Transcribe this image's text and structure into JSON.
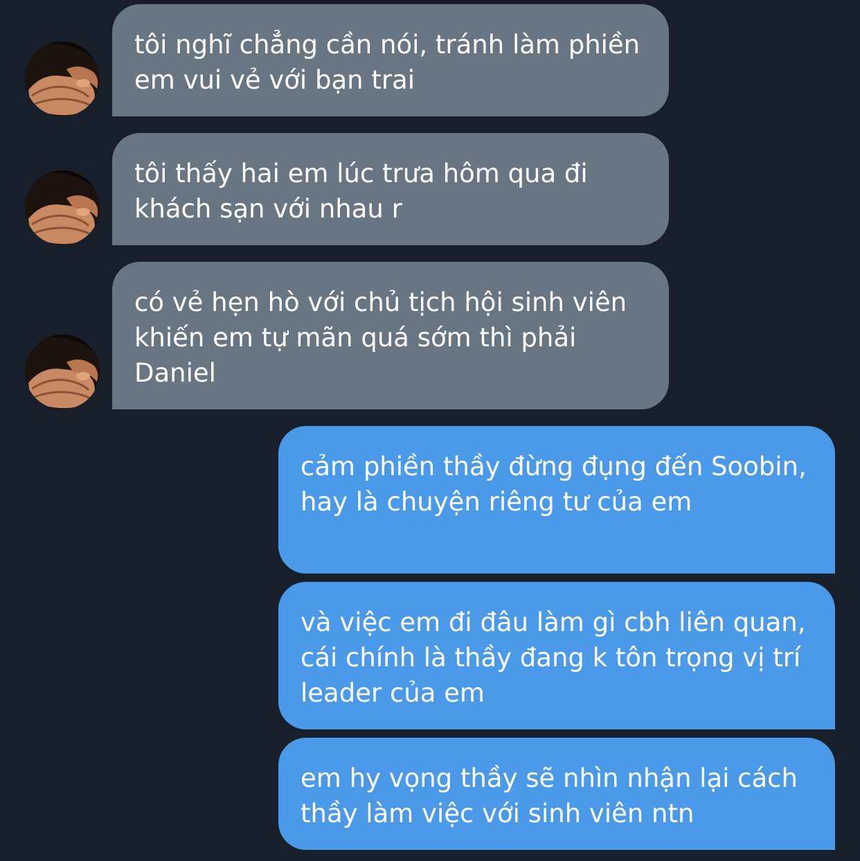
{
  "messages": [
    {
      "direction": "incoming",
      "text": "tôi nghĩ chẳng cần nói, tránh làm phiền em vui vẻ với bạn trai"
    },
    {
      "direction": "incoming",
      "text": "tôi thấy hai em lúc trưa hôm qua đi khách sạn với nhau r"
    },
    {
      "direction": "incoming",
      "text": "có vẻ hẹn hò với chủ tịch hội sinh viên khiến em tự mãn quá sớm thì phải Daniel"
    },
    {
      "direction": "outgoing",
      "text": "cảm phiền thầy đừng đụng đến Soobin, hay là chuyện riêng tư của em"
    },
    {
      "direction": "outgoing",
      "text": "và việc em đi đâu làm gì cbh liên quan, cái chính là thầy đang k tôn trọng vị trí leader của em"
    },
    {
      "direction": "outgoing",
      "text": "em hy vọng thầy sẽ nhìn nhận lại cách thầy làm việc với sinh viên ntn"
    }
  ],
  "colors": {
    "background": "#17202a",
    "incoming_bubble": "#687583",
    "outgoing_bubble": "#4a9ae9",
    "text": "#ffffff"
  },
  "icons": {
    "avatar": "sender-avatar-photo"
  }
}
